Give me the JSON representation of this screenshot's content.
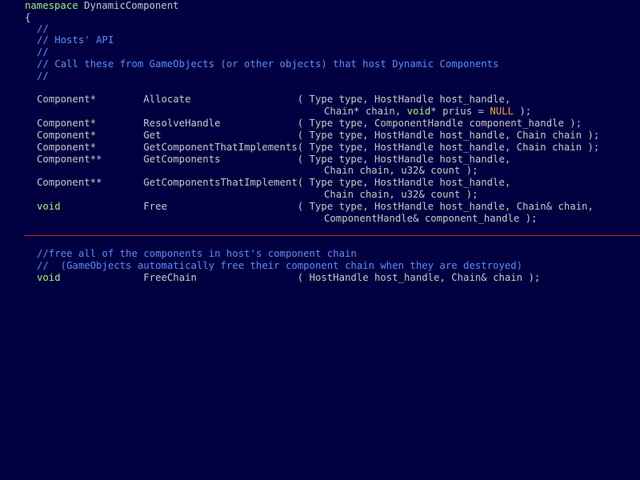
{
  "colors": {
    "background": "#000040",
    "keyword": "#a0f070",
    "text": "#c8c8c8",
    "comment": "#5a8cff",
    "null_literal": "#f0a040",
    "separator": "#d02020"
  },
  "header": {
    "keyword_namespace": "namespace",
    "namespace_name": " DynamicComponent",
    "open_brace": "{"
  },
  "comments_top": [
    "//",
    "// Hosts' API",
    "//",
    "// Call these from GameObjects (or other objects) that host Dynamic Components",
    "//"
  ],
  "declarations": {
    "allocate_1": "Component*        Allocate                  ( Type type, HostHandle host_handle,",
    "allocate_2a": "Chain* chain, ",
    "allocate_2b": "void",
    "allocate_2c": "* prius = ",
    "allocate_2d": "NULL",
    "allocate_2e": " );",
    "resolve": "Component*        ResolveHandle             ( Type type, ComponentHandle component_handle );",
    "get": "Component*        Get                       ( Type type, HostHandle host_handle, Chain chain );",
    "get_impl": "Component*        GetComponentThatImplements( Type type, HostHandle host_handle, Chain chain );",
    "get_comps_1": "Component**       GetComponents             ( Type type, HostHandle host_handle,",
    "get_comps_2": "Chain chain, u32& count );",
    "get_impls_1": "Component**       GetComponentsThatImplement( Type type, HostHandle host_handle,",
    "get_impls_2": "Chain chain, u32& count );",
    "free_kw": "void",
    "free_rest": "              Free                      ( Type type, HostHandle host_handle, Chain& chain,",
    "free_2": "ComponentHandle& component_handle );"
  },
  "comments_bottom": [
    "//free all of the components in host's component chain",
    "//  (GameObjects automatically free their component chain when they are destroyed)"
  ],
  "freechain": {
    "kw": "void",
    "rest": "              FreeChain                 ( HostHandle host_handle, Chain& chain );"
  }
}
